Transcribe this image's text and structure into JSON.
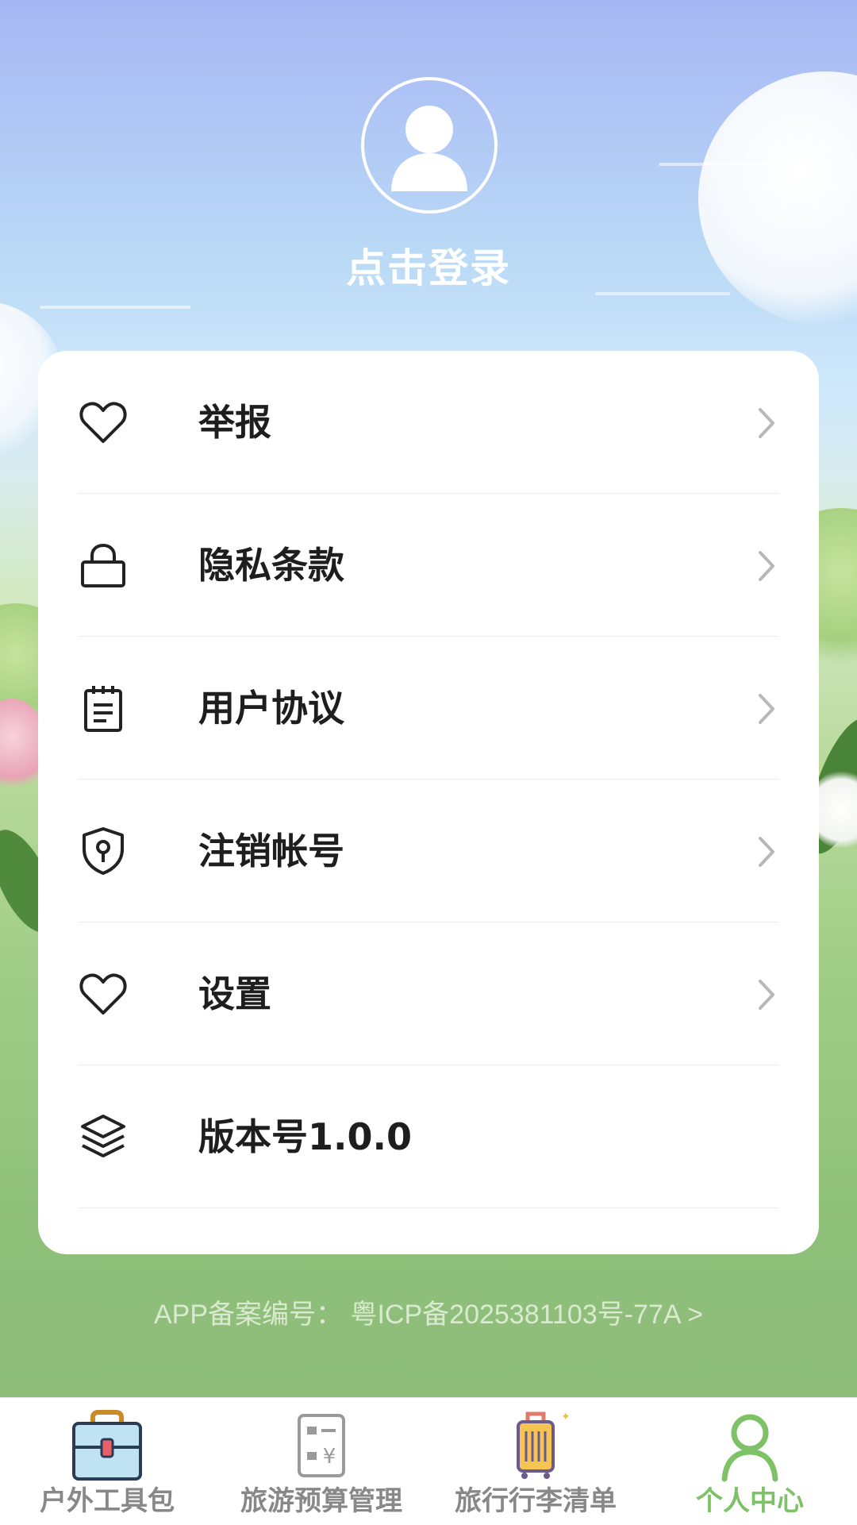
{
  "profile": {
    "login_label": "点击登录",
    "avatar_icon": "user-avatar-icon"
  },
  "menu": {
    "items": [
      {
        "label": "举报",
        "icon": "heart-icon",
        "has_chevron": true
      },
      {
        "label": "隐私条款",
        "icon": "lock-icon",
        "has_chevron": true
      },
      {
        "label": "用户协议",
        "icon": "clipboard-icon",
        "has_chevron": true
      },
      {
        "label": "注销帐号",
        "icon": "shield-key-icon",
        "has_chevron": true
      },
      {
        "label": "设置",
        "icon": "heart-icon",
        "has_chevron": true
      },
      {
        "label": "版本号1.0.0",
        "icon": "layers-icon",
        "has_chevron": false
      }
    ]
  },
  "footer": {
    "icp_text": "APP备案编号： 粤ICP备2025381103号-77A >"
  },
  "tabbar": {
    "tabs": [
      {
        "label": "户外工具包",
        "icon": "toolbox-icon",
        "active": false
      },
      {
        "label": "旅游预算管理",
        "icon": "budget-icon",
        "active": false
      },
      {
        "label": "旅行行李清单",
        "icon": "luggage-icon",
        "active": false
      },
      {
        "label": "个人中心",
        "icon": "person-icon",
        "active": true
      }
    ]
  },
  "colors": {
    "accent": "#7dc266",
    "inactive_tab": "#888888",
    "card_bg": "#ffffff",
    "text": "#1e1e1e"
  }
}
